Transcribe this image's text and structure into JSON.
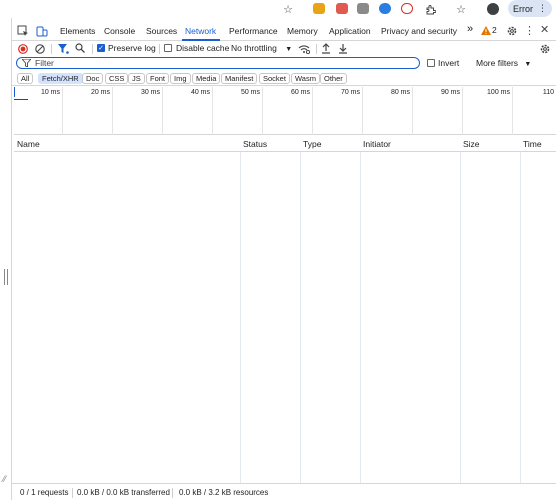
{
  "browser": {
    "error_label": "Error",
    "error_menu_glyph": "⋮"
  },
  "devtools": {
    "tabs": [
      "Elements",
      "Console",
      "Sources",
      "Network",
      "Performance",
      "Memory",
      "Application",
      "Privacy and security"
    ],
    "active_tab": "Network",
    "more_tabs": "»",
    "warning_count": "2"
  },
  "toolbar": {
    "preserve_log_label": "Preserve log",
    "preserve_log_checked": true,
    "disable_cache_label": "Disable cache",
    "disable_cache_checked": false,
    "throttling_value": "No throttling"
  },
  "filter": {
    "placeholder": "Filter",
    "invert_label": "Invert",
    "more_filters_label": "More filters"
  },
  "type_filters": [
    "All",
    "Fetch/XHR",
    "Doc",
    "CSS",
    "JS",
    "Font",
    "Img",
    "Media",
    "Manifest",
    "Socket",
    "Wasm",
    "Other"
  ],
  "active_type_filter": "Fetch/XHR",
  "timeline": {
    "ticks": [
      "10 ms",
      "20 ms",
      "30 ms",
      "40 ms",
      "50 ms",
      "60 ms",
      "70 ms",
      "80 ms",
      "90 ms",
      "100 ms",
      "110"
    ]
  },
  "table": {
    "columns": [
      "Name",
      "Status",
      "Type",
      "Initiator",
      "Size",
      "Time"
    ],
    "rows": []
  },
  "status_bar": {
    "requests": "0 / 1 requests",
    "transferred": "0.0 kB / 0.0 kB transferred",
    "resources": "0.0 kB / 3.2 kB resources"
  },
  "colors": {
    "accent": "#1a5fd0",
    "chip_active_bg": "#d3e3fd",
    "record_red": "#d93025",
    "warning_orange": "#e37400"
  }
}
